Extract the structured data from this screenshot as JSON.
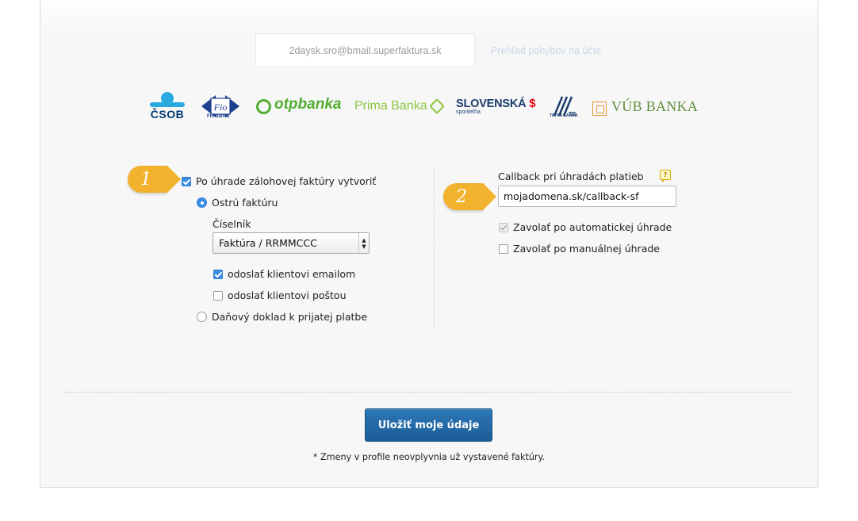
{
  "header": {
    "email": "2daysk.sro@bmail.superfaktura.sk",
    "account_link": "Prehľad pohybov na účte"
  },
  "banks": [
    {
      "name": "ČSOB",
      "icon": "csob-logo-icon"
    },
    {
      "name": "Fio",
      "sub": "Fio banka",
      "icon": "fio-logo-icon"
    },
    {
      "name": "otpbanka",
      "icon": "otp-logo-icon"
    },
    {
      "name": "Prima Banka",
      "icon": "prima-logo-icon"
    },
    {
      "name": "SLOVENSKÁ",
      "sub": "sporiteľňa",
      "icon": "slsp-logo-icon"
    },
    {
      "name": "TB",
      "sub": "TATRA BANKA",
      "icon": "tatra-logo-icon"
    },
    {
      "name": "VÚB BANKA",
      "icon": "vub-logo-icon"
    }
  ],
  "left": {
    "badge": "1",
    "create_invoice_label": "Po úhrade zálohovej faktúry vytvoriť",
    "create_invoice_checked": true,
    "sharp_invoice_label": "Ostrú faktúru",
    "sharp_invoice_selected": true,
    "numbering_label": "Číselník",
    "numbering_value": "Faktúra / RRMMCCC",
    "send_email_label": "odoslať klientovi emailom",
    "send_email_checked": true,
    "send_post_label": "odoslať klientovi poštou",
    "send_post_checked": false,
    "tax_doc_label": "Daňový doklad k prijatej platbe",
    "tax_doc_selected": false
  },
  "right": {
    "badge": "2",
    "callback_label": "Callback pri úhradách platieb",
    "help_icon": "?",
    "callback_value": "mojadomena.sk/callback-sf",
    "auto_call_label": "Zavolať po automatickej úhrade",
    "auto_call_checked": true,
    "manual_call_label": "Zavolať po manuálnej úhrade",
    "manual_call_checked": false
  },
  "footer": {
    "save_label": "Uložiť moje údaje",
    "note": "* Zmeny v profile neovplyvnia už vystavené faktúry."
  },
  "colors": {
    "badge": "#f2b22d",
    "primary_button": "#1f65a3",
    "checkbox_on": "#3b8ee8"
  }
}
